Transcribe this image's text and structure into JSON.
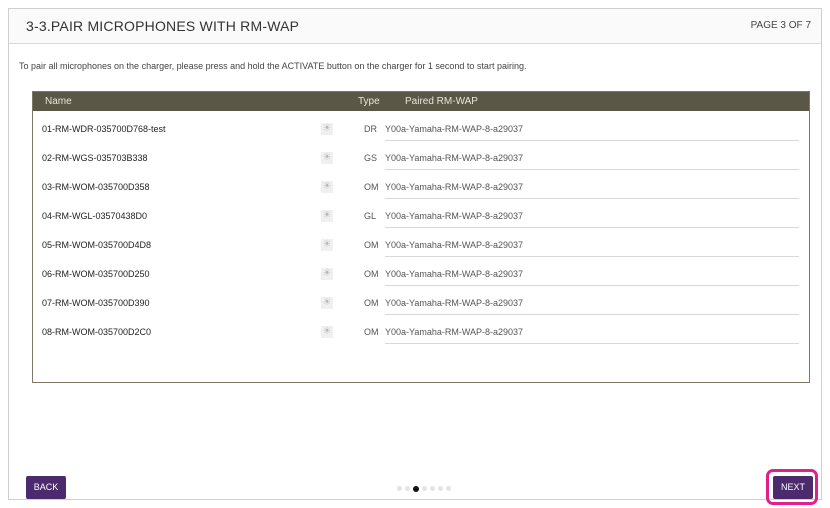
{
  "header": {
    "title": "3-3.PAIR MICROPHONES WITH RM-WAP",
    "page_indicator": "PAGE 3 OF 7"
  },
  "instruction": "To pair all microphones on the charger, please press and hold the ACTIVATE button on the charger for 1 second to start pairing.",
  "table": {
    "columns": [
      "Name",
      "Type",
      "Paired RM-WAP"
    ],
    "rows": [
      {
        "name": "01-RM-WDR-035700D768-test",
        "indicator_icon": "sun-icon",
        "type": "DR",
        "paired": "Y00a-Yamaha-RM-WAP-8-a29037"
      },
      {
        "name": "02-RM-WGS-035703B338",
        "indicator_icon": "sun-icon",
        "type": "GS",
        "paired": "Y00a-Yamaha-RM-WAP-8-a29037"
      },
      {
        "name": "03-RM-WOM-035700D358",
        "indicator_icon": "sun-icon",
        "type": "OM",
        "paired": "Y00a-Yamaha-RM-WAP-8-a29037"
      },
      {
        "name": "04-RM-WGL-03570438D0",
        "indicator_icon": "sun-icon",
        "type": "GL",
        "paired": "Y00a-Yamaha-RM-WAP-8-a29037"
      },
      {
        "name": "05-RM-WOM-035700D4D8",
        "indicator_icon": "sun-icon",
        "type": "OM",
        "paired": "Y00a-Yamaha-RM-WAP-8-a29037"
      },
      {
        "name": "06-RM-WOM-035700D250",
        "indicator_icon": "sun-icon",
        "type": "OM",
        "paired": "Y00a-Yamaha-RM-WAP-8-a29037"
      },
      {
        "name": "07-RM-WOM-035700D390",
        "indicator_icon": "sun-icon",
        "type": "OM",
        "paired": "Y00a-Yamaha-RM-WAP-8-a29037"
      },
      {
        "name": "08-RM-WOM-035700D2C0",
        "indicator_icon": "sun-icon",
        "type": "OM",
        "paired": "Y00a-Yamaha-RM-WAP-8-a29037"
      }
    ]
  },
  "footer": {
    "back_label": "BACK",
    "next_label": "NEXT",
    "dots_total": 7,
    "dots_active_index": 2
  },
  "colors": {
    "table_header_bg": "#5a5747",
    "button_bg": "#4b2b6e",
    "highlight": "#e0218a"
  }
}
